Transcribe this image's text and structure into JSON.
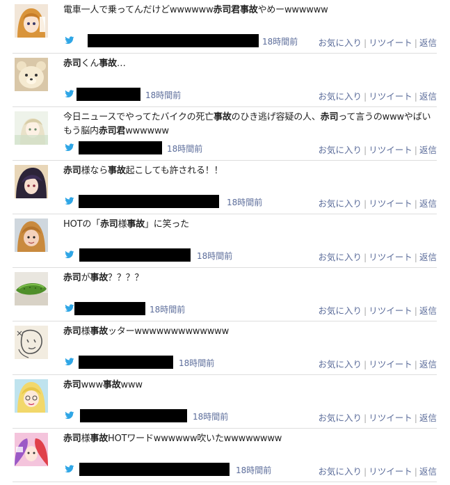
{
  "actions": {
    "favorite": "お気に入り",
    "retweet": "リツイート",
    "reply": "返信",
    "separator": "|"
  },
  "colors": {
    "link": "#5b6c9a",
    "twitter_bird": "#2fa6e6",
    "divider": "#dddddd"
  },
  "tweets": [
    {
      "segments": [
        {
          "t": "電車一人で乗ってんだけどwwwwww",
          "b": false
        },
        {
          "t": "赤司君事故",
          "b": true
        },
        {
          "t": "やめーwwwwww",
          "b": false
        }
      ],
      "time": "18時間前",
      "avatar": "anime-girl-avatar"
    },
    {
      "segments": [
        {
          "t": "赤司",
          "b": true
        },
        {
          "t": "くん",
          "b": false
        },
        {
          "t": "事故",
          "b": true
        },
        {
          "t": "…",
          "b": false
        }
      ],
      "time": "18時間前",
      "avatar": "bear-plush-avatar"
    },
    {
      "segments": [
        {
          "t": "今日ニュースでやってたバイクの死亡",
          "b": false
        },
        {
          "t": "事故",
          "b": true
        },
        {
          "t": "のひき逃げ容疑の人、",
          "b": false
        },
        {
          "t": "赤司",
          "b": true
        },
        {
          "t": "って言うのwwwやばいもう脳内",
          "b": false
        },
        {
          "t": "赤司君",
          "b": true
        },
        {
          "t": "wwwwww",
          "b": false
        }
      ],
      "time": "18時間前",
      "avatar": "light-anime-avatar"
    },
    {
      "segments": [
        {
          "t": "赤司",
          "b": true
        },
        {
          "t": "様なら",
          "b": false
        },
        {
          "t": "事故",
          "b": true
        },
        {
          "t": "起こしても許される！！",
          "b": false
        }
      ],
      "time": "18時間前",
      "avatar": "dark-anime-avatar"
    },
    {
      "segments": [
        {
          "t": "HOTの「",
          "b": false
        },
        {
          "t": "赤司",
          "b": true
        },
        {
          "t": "様",
          "b": false
        },
        {
          "t": "事故",
          "b": true
        },
        {
          "t": "」に笑った",
          "b": false
        }
      ],
      "time": "18時間前",
      "avatar": "photo-girl-avatar"
    },
    {
      "segments": [
        {
          "t": "赤司",
          "b": true
        },
        {
          "t": "が",
          "b": false
        },
        {
          "t": "事故",
          "b": true
        },
        {
          "t": "？？？？",
          "b": false
        }
      ],
      "time": "18時間前",
      "avatar": "cucumber-avatar"
    },
    {
      "segments": [
        {
          "t": "赤司",
          "b": true
        },
        {
          "t": "様",
          "b": false
        },
        {
          "t": "事故",
          "b": true
        },
        {
          "t": "ッターwwwwwwwwwwwww",
          "b": false
        }
      ],
      "time": "18時間前",
      "avatar": "sketch-avatar"
    },
    {
      "segments": [
        {
          "t": "赤司",
          "b": true
        },
        {
          "t": "www",
          "b": false
        },
        {
          "t": "事故",
          "b": true
        },
        {
          "t": "www",
          "b": false
        }
      ],
      "time": "18時間前",
      "avatar": "blonde-anime-avatar"
    },
    {
      "segments": [
        {
          "t": "赤司",
          "b": true
        },
        {
          "t": "様",
          "b": false
        },
        {
          "t": "事故",
          "b": true
        },
        {
          "t": "HOTワードwwwwww吹いたwwwwwwww",
          "b": false
        }
      ],
      "time": "18時間前",
      "avatar": "colorful-anime-avatar"
    }
  ]
}
